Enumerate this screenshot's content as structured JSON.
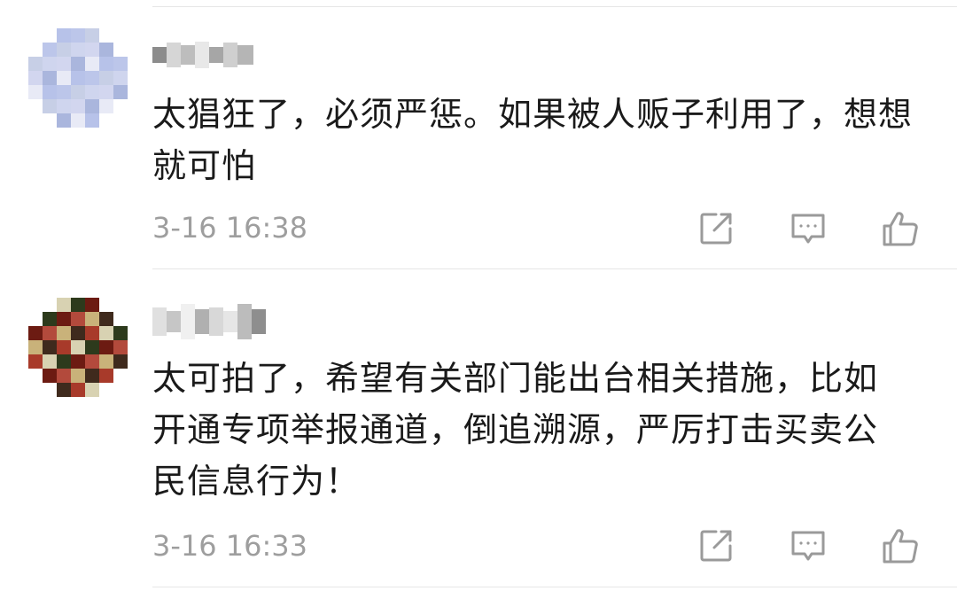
{
  "comments": [
    {
      "text": "太猖狂了，必须严惩。如果被人贩子利用了，想想\n就可怕",
      "time": "3-16 16:38",
      "avatar_colors": [
        "#c7cfe6",
        "#aab6dd",
        "#bcc6ea",
        "#d2d6ef",
        "#b7c2e9",
        "#cfd5ee",
        "#e8eaf6"
      ],
      "actions": [
        "share-icon",
        "comment-icon",
        "like-icon"
      ]
    },
    {
      "text": "太可拍了，希望有关部门能出台相关措施，比如\n开通专项举报通道，倒追溯源，严厉打击买卖公\n民信息行为！",
      "time": "3-16 16:33",
      "avatar_colors": [
        "#a83a2a",
        "#6c1b12",
        "#3f2a1d",
        "#2d3a1c",
        "#c9b27a",
        "#d8d2b2",
        "#b34a3c"
      ],
      "actions": [
        "share-icon",
        "comment-icon",
        "like-icon"
      ]
    }
  ]
}
